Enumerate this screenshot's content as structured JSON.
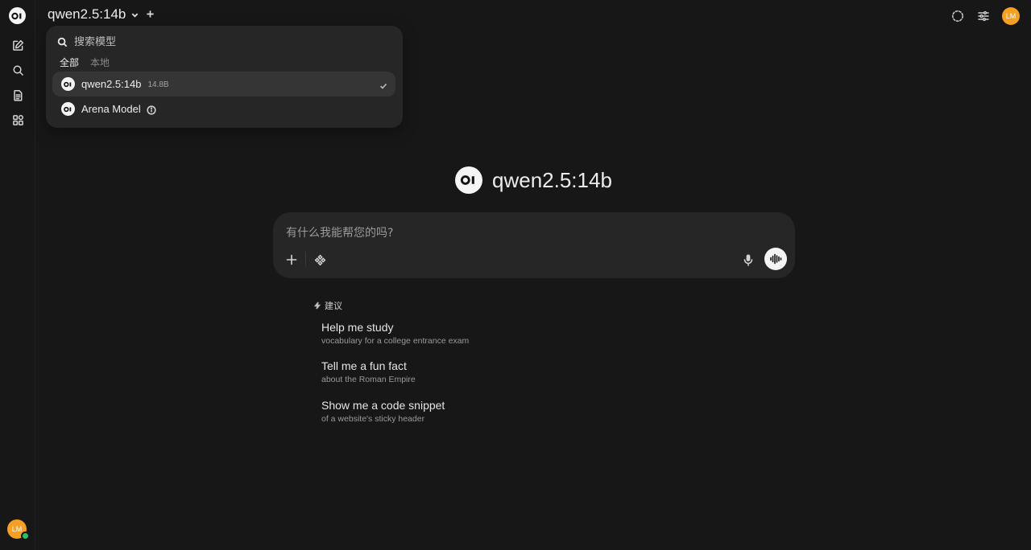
{
  "sidebar": {
    "avatar_initials": "LM"
  },
  "header": {
    "model_name": "qwen2.5:14b",
    "avatar_initials": "LM"
  },
  "model_dropdown": {
    "search_placeholder": "搜索模型",
    "tabs": [
      {
        "label": "全部",
        "active": true
      },
      {
        "label": "本地",
        "active": false
      }
    ],
    "models": [
      {
        "name": "qwen2.5:14b",
        "size": "14.8B",
        "selected": true
      },
      {
        "name": "Arena Model",
        "size": "",
        "selected": false
      }
    ]
  },
  "welcome": {
    "model_name": "qwen2.5:14b"
  },
  "composer": {
    "placeholder": "有什么我能帮您的吗?"
  },
  "suggestions": {
    "heading": "建议",
    "items": [
      {
        "title": "Help me study",
        "subtitle": "vocabulary for a college entrance exam"
      },
      {
        "title": "Tell me a fun fact",
        "subtitle": "about the Roman Empire"
      },
      {
        "title": "Show me a code snippet",
        "subtitle": "of a website's sticky header"
      }
    ]
  },
  "colors": {
    "background": "#171717",
    "panel": "#262626",
    "avatar": "#f5a023",
    "online": "#22c55e"
  }
}
